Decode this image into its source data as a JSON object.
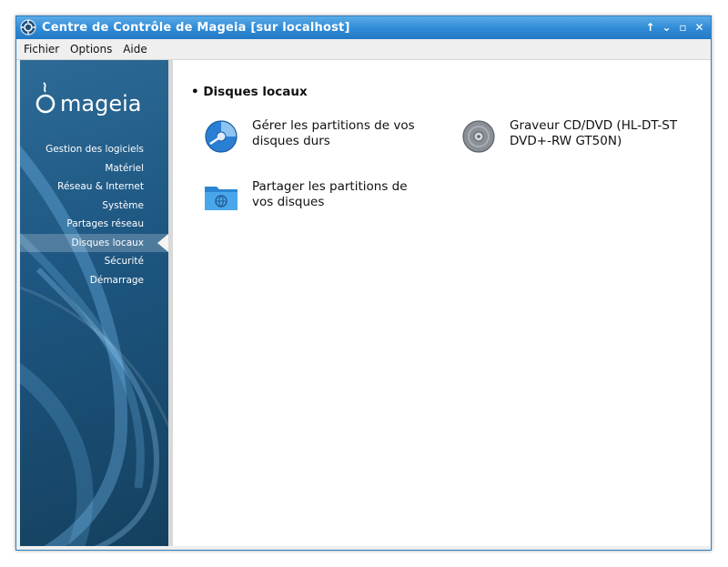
{
  "window": {
    "title": "Centre de Contrôle de Mageia  [sur localhost]",
    "controls": [
      "↑",
      "⌄",
      "▫",
      "✕"
    ]
  },
  "menu": [
    "Fichier",
    "Options",
    "Aide"
  ],
  "sidebar": {
    "logo_text": "mageia",
    "items": [
      {
        "label": "Gestion des logiciels",
        "active": false
      },
      {
        "label": "Matériel",
        "active": false
      },
      {
        "label": "Réseau & Internet",
        "active": false
      },
      {
        "label": "Système",
        "active": false
      },
      {
        "label": "Partages réseau",
        "active": false
      },
      {
        "label": "Disques locaux",
        "active": true
      },
      {
        "label": "Sécurité",
        "active": false
      },
      {
        "label": "Démarrage",
        "active": false
      }
    ]
  },
  "main": {
    "section_title": "• Disques locaux",
    "tools": [
      {
        "label": "Gérer les partitions de vos disques durs",
        "icon": "disk-partition-icon"
      },
      {
        "label": "Graveur CD/DVD (HL-DT-ST DVD+-RW GT50N)",
        "icon": "cd-dvd-icon"
      },
      {
        "label": "Partager les partitions de vos disques",
        "icon": "shared-folder-icon"
      }
    ]
  },
  "colors": {
    "titlebar": "#2f8ad6",
    "sidebar": "#1e5782",
    "accent": "#3a8ee0"
  }
}
